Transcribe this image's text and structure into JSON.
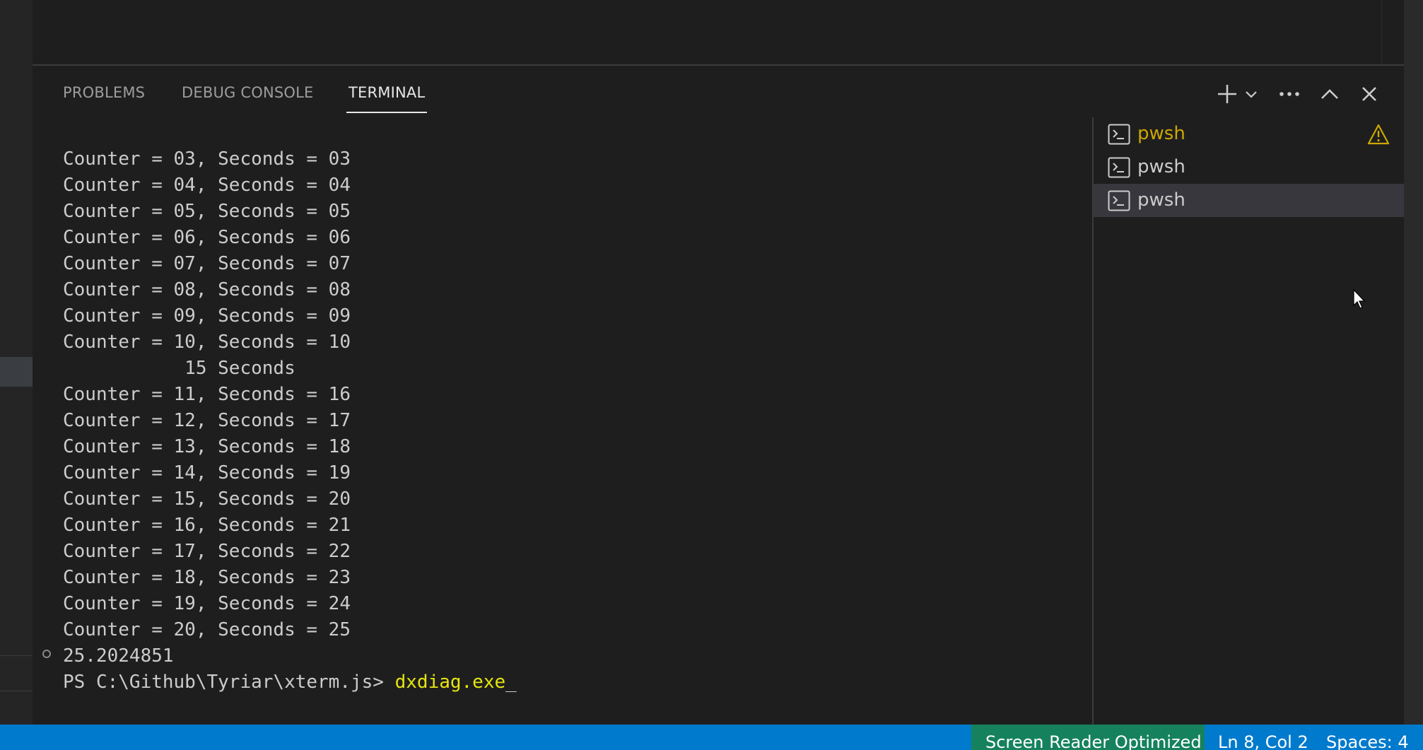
{
  "panel": {
    "tabs": [
      {
        "label": "PROBLEMS",
        "active": false
      },
      {
        "label": "DEBUG CONSOLE",
        "active": false
      },
      {
        "label": "TERMINAL",
        "active": true
      }
    ],
    "actions": [
      "plus-icon",
      "chevron-down-icon",
      "ellipsis-icon",
      "chevron-up-icon",
      "close-icon"
    ]
  },
  "terminal": {
    "lines": [
      "Counter = 03, Seconds = 03",
      "Counter = 04, Seconds = 04",
      "Counter = 05, Seconds = 05",
      "Counter = 06, Seconds = 06",
      "Counter = 07, Seconds = 07",
      "Counter = 08, Seconds = 08",
      "Counter = 09, Seconds = 09",
      "Counter = 10, Seconds = 10",
      "           15 Seconds",
      "Counter = 11, Seconds = 16",
      "Counter = 12, Seconds = 17",
      "Counter = 13, Seconds = 18",
      "Counter = 14, Seconds = 19",
      "Counter = 15, Seconds = 20",
      "Counter = 16, Seconds = 21",
      "Counter = 17, Seconds = 22",
      "Counter = 18, Seconds = 23",
      "Counter = 19, Seconds = 24",
      "Counter = 20, Seconds = 25",
      "25.2024851"
    ],
    "prompt": "PS C:\\Github\\Tyriar\\xterm.js> ",
    "command": "dxdiag.exe",
    "cursor": "_"
  },
  "terminal_tabs": [
    {
      "label": "pwsh",
      "warning": true,
      "selected": false
    },
    {
      "label": "pwsh",
      "warning": false,
      "selected": false
    },
    {
      "label": "pwsh",
      "warning": false,
      "selected": true
    }
  ],
  "statusbar": {
    "screen_reader": "Screen Reader Optimized",
    "position": "Ln 8, Col 2",
    "spaces": "Spaces: 4"
  },
  "colors": {
    "statusbar_bg": "#007acc",
    "screen_reader_bg": "#16825d",
    "warning": "#cca700",
    "command": "#e5e510"
  }
}
